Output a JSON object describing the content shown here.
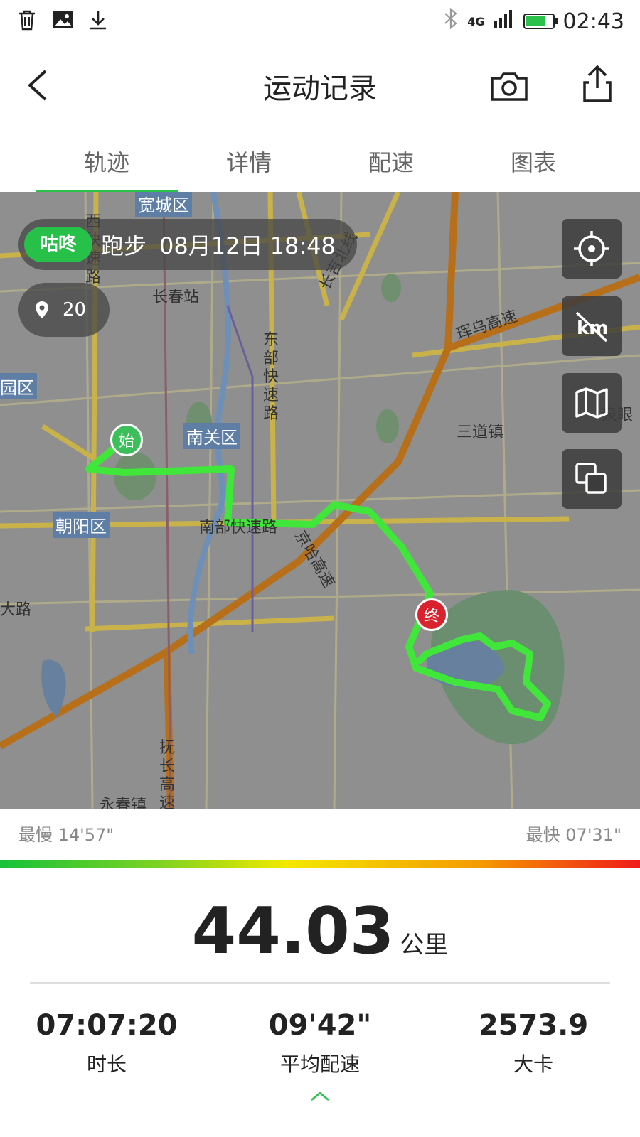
{
  "status": {
    "network": "4G",
    "time": "02:43",
    "battery_level": 0.75
  },
  "header": {
    "title": "运动记录"
  },
  "tabs": [
    {
      "label": "轨迹",
      "active": true
    },
    {
      "label": "详情",
      "active": false
    },
    {
      "label": "配速",
      "active": false
    },
    {
      "label": "图表",
      "active": false
    }
  ],
  "map": {
    "app_badge": "咕咚",
    "activity_type": "跑步",
    "datetime": "08月12日 18:48",
    "photo_count": "20",
    "start_marker": "始",
    "end_marker": "终",
    "labels": {
      "kuancheng": "宽城区",
      "changchun_station": "长春站",
      "nanguan": "南关区",
      "chaoyang": "朝阳区",
      "luyuan": "绿园区",
      "xi_kuaisu": "西快速路",
      "dongbu_kuaisu": "东部快速路",
      "nanbu_kuaisu": "南部快速路",
      "hunwu_gaosu": "珲乌高速",
      "jingha_gaosu": "京哈高速",
      "changji_beixian": "长吉北线",
      "sandao": "三道镇",
      "fuchang_gaosu": "抚长高速",
      "yongchun": "永春镇",
      "dalu": "大路",
      "quanyan": "泉眼"
    }
  },
  "pace": {
    "slowest": "最慢 14'57\"",
    "fastest": "最快 07'31\""
  },
  "summary": {
    "distance": "44.03",
    "distance_unit": "公里",
    "duration": "07:07:20",
    "duration_label": "时长",
    "avg_pace": "09'42\"",
    "avg_pace_label": "平均配速",
    "calories": "2573.9",
    "calories_label": "大卡"
  }
}
